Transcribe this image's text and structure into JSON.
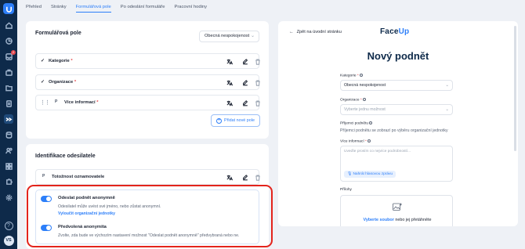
{
  "sidebar": {
    "logo": "faceup-logo",
    "items": [
      {
        "icon": "home-icon"
      },
      {
        "icon": "chart-icon"
      },
      {
        "icon": "inbox-icon",
        "badge": "2"
      },
      {
        "icon": "briefcase-icon"
      },
      {
        "icon": "folder-icon"
      },
      {
        "icon": "doc-icon"
      },
      {
        "icon": "flow-icon",
        "active": true
      },
      {
        "icon": "database-icon"
      },
      {
        "icon": "people-icon"
      },
      {
        "icon": "grid-icon"
      },
      {
        "icon": "puzzle-icon"
      },
      {
        "icon": "settings-icon"
      }
    ],
    "help": "?",
    "avatar": "VS"
  },
  "tabs": [
    {
      "label": "Přehled"
    },
    {
      "label": "Stránky"
    },
    {
      "label": "Formulářová pole",
      "active": true
    },
    {
      "label": "Po odeslání formuláře"
    },
    {
      "label": "Pracovní hodiny"
    }
  ],
  "fields_card": {
    "title": "Formulářová pole",
    "category_select": "Obecná nespokojenost",
    "fields": [
      {
        "label": "Kategorie",
        "required": "*"
      },
      {
        "label": "Organizace",
        "required": "*"
      },
      {
        "label": "Více informací",
        "required": "*",
        "chip": "P"
      }
    ],
    "add_button": "Přidat nové pole"
  },
  "ident_card": {
    "title": "Identifikace odesilatele",
    "field": {
      "label": "Totožnost oznamovatele",
      "chip": "P"
    },
    "anonymous_toggle": {
      "title": "Odeslat podnět anonymně",
      "description": "Odesilatel může uvést své jméno, nebo zůstat anonymní.",
      "link": "Vyloučit organizační jednotky",
      "on": true
    },
    "default_toggle": {
      "title": "Předvolená anonymita",
      "description": "Zvolte, zda bude ve výchozím nastavení možnost \"Odeslat podnět anonymně\" předvybraná nebo ne.",
      "on": true
    }
  },
  "preview": {
    "back": "Zpět na úvodní stránku",
    "brand_a": "Face",
    "brand_b": "Up",
    "title": "Nový podnět",
    "kategorie_label": "Kategorie",
    "kategorie_value": "Obecná nespokojenost",
    "organizace_label": "Organizace",
    "organizace_placeholder": "Vyberte jednu možnost",
    "prijemci_label": "Příjemci podnětu",
    "prijemci_text": "Příjemci podnětu se zobrazí po výběru organizační jednotky",
    "vice_label": "Více informací",
    "vice_placeholder": "Uveďte prosím co nejvíce podrobností...",
    "voice_button": "Nahrát hlasovou zprávu",
    "prilohy_label": "Přílohy",
    "upload_link": "Vyberte soubor",
    "upload_rest": "nebo jej přetáhněte",
    "required": "*"
  },
  "colors": {
    "accent": "#2d7ff9",
    "sidebar": "#0e2a4a",
    "highlight": "#e3241c"
  }
}
